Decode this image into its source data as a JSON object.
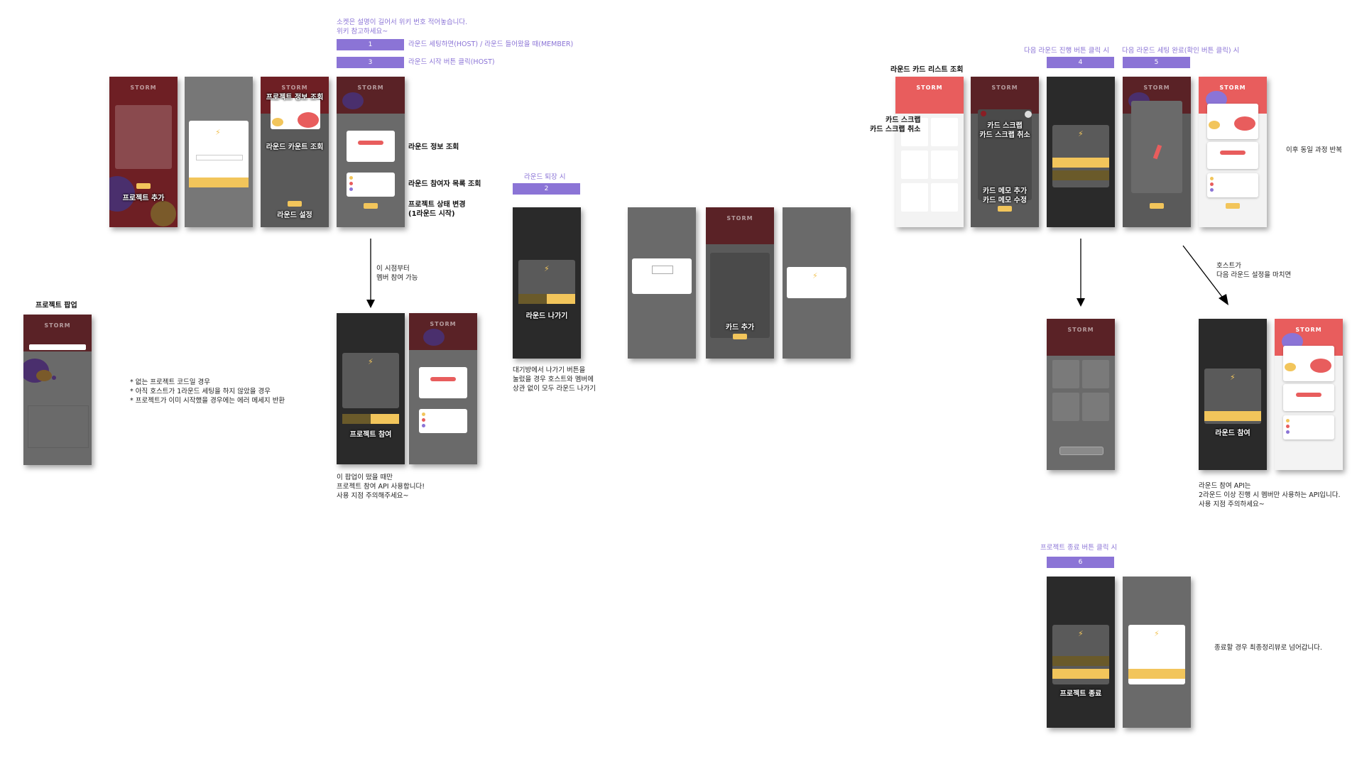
{
  "header_note": [
    "소켓은 설명이 길어서 위키 번호 적어놓습니다.",
    "위키 참고하세요~"
  ],
  "socket_steps": [
    {
      "num": "1",
      "label": "라운드 세팅하면(HOST) / 라운드 들어왔을 때(MEMBER)"
    },
    {
      "num": "3",
      "label": "라운드 시작 버튼 클릭(HOST)"
    },
    {
      "num": "2",
      "title": "라운드 퇴장 시"
    },
    {
      "num": "4",
      "title": "다음 라운드 진행 버튼 클릭 시"
    },
    {
      "num": "5",
      "title": "다음 라운드 세팅 완료(확인 버튼 클릭) 시"
    },
    {
      "num": "6",
      "title": "프로젝트 종료 버튼 클릭 시"
    }
  ],
  "screen_labels": {
    "project_add": "프로젝트 추가",
    "project_info": "프로젝트 정보 조회",
    "round_count": "라운드 카운트 조회",
    "round_setting": "라운드 설정",
    "project_join": "프로젝트 참여",
    "round_leave": "라운드 나가기",
    "card_add": "카드 추가",
    "scrap": [
      "카드 스크랩",
      "카드 스크랩 취소"
    ],
    "memo": [
      "카드 메모 추가",
      "카드 메모 수정"
    ],
    "round_join": "라운드 참여",
    "project_end": "프로젝트 종료"
  },
  "side_labels": {
    "round_info": "라운드 정보 조회",
    "participants": "라운드 참여자 목록 조회",
    "status_change": [
      "프로젝트 상태 변경",
      "(1라운드 시작)"
    ],
    "card_list": "라운드 카드 리스트 조회",
    "scrap_left": [
      "카드 스크랩",
      "카드 스크랩 취소"
    ],
    "project_popup": "프로젝트 팝업"
  },
  "notes": {
    "member_join": [
      "이 시점부터",
      "멤버 참여 가능"
    ],
    "join_api": [
      "이 팝업이 떴을 때만",
      "프로젝트 참여 API 사용합니다!",
      "사용 지점 주의해주세요~"
    ],
    "errors": [
      "* 없는 프로젝트 코드일 경우",
      "* 아직 호스트가 1라운드 세팅을 하지 않았을 경우",
      "* 프로젝트가 이미 시작했을 경우에는 에러 메세지 반환"
    ],
    "leave": [
      "대기방에서 나가기 버튼을",
      "눌렀을 경우 호스트와 멤버에",
      "상관 없이 모두 라운드 나가기"
    ],
    "repeat": "이후 동일 과정 반복",
    "host_next": [
      "호스트가",
      "다음 라운드 설정을 마치면"
    ],
    "round_join_api": [
      "라운드 참여 API는",
      "2라운드 이상 진행 시 멤버만 사용하는 API입니다.",
      "사용 지점 주의하세요~"
    ],
    "end_review": "종료할 경우 최종정리뷰로 넘어갑니다."
  },
  "app_logo": "STORM",
  "colors": {
    "purple": "#8b74d6",
    "maroon": "#6e1f24",
    "coral": "#e85d5d",
    "yellow": "#f2c55b",
    "dark": "#2a2a2a",
    "grey": "#777777"
  }
}
